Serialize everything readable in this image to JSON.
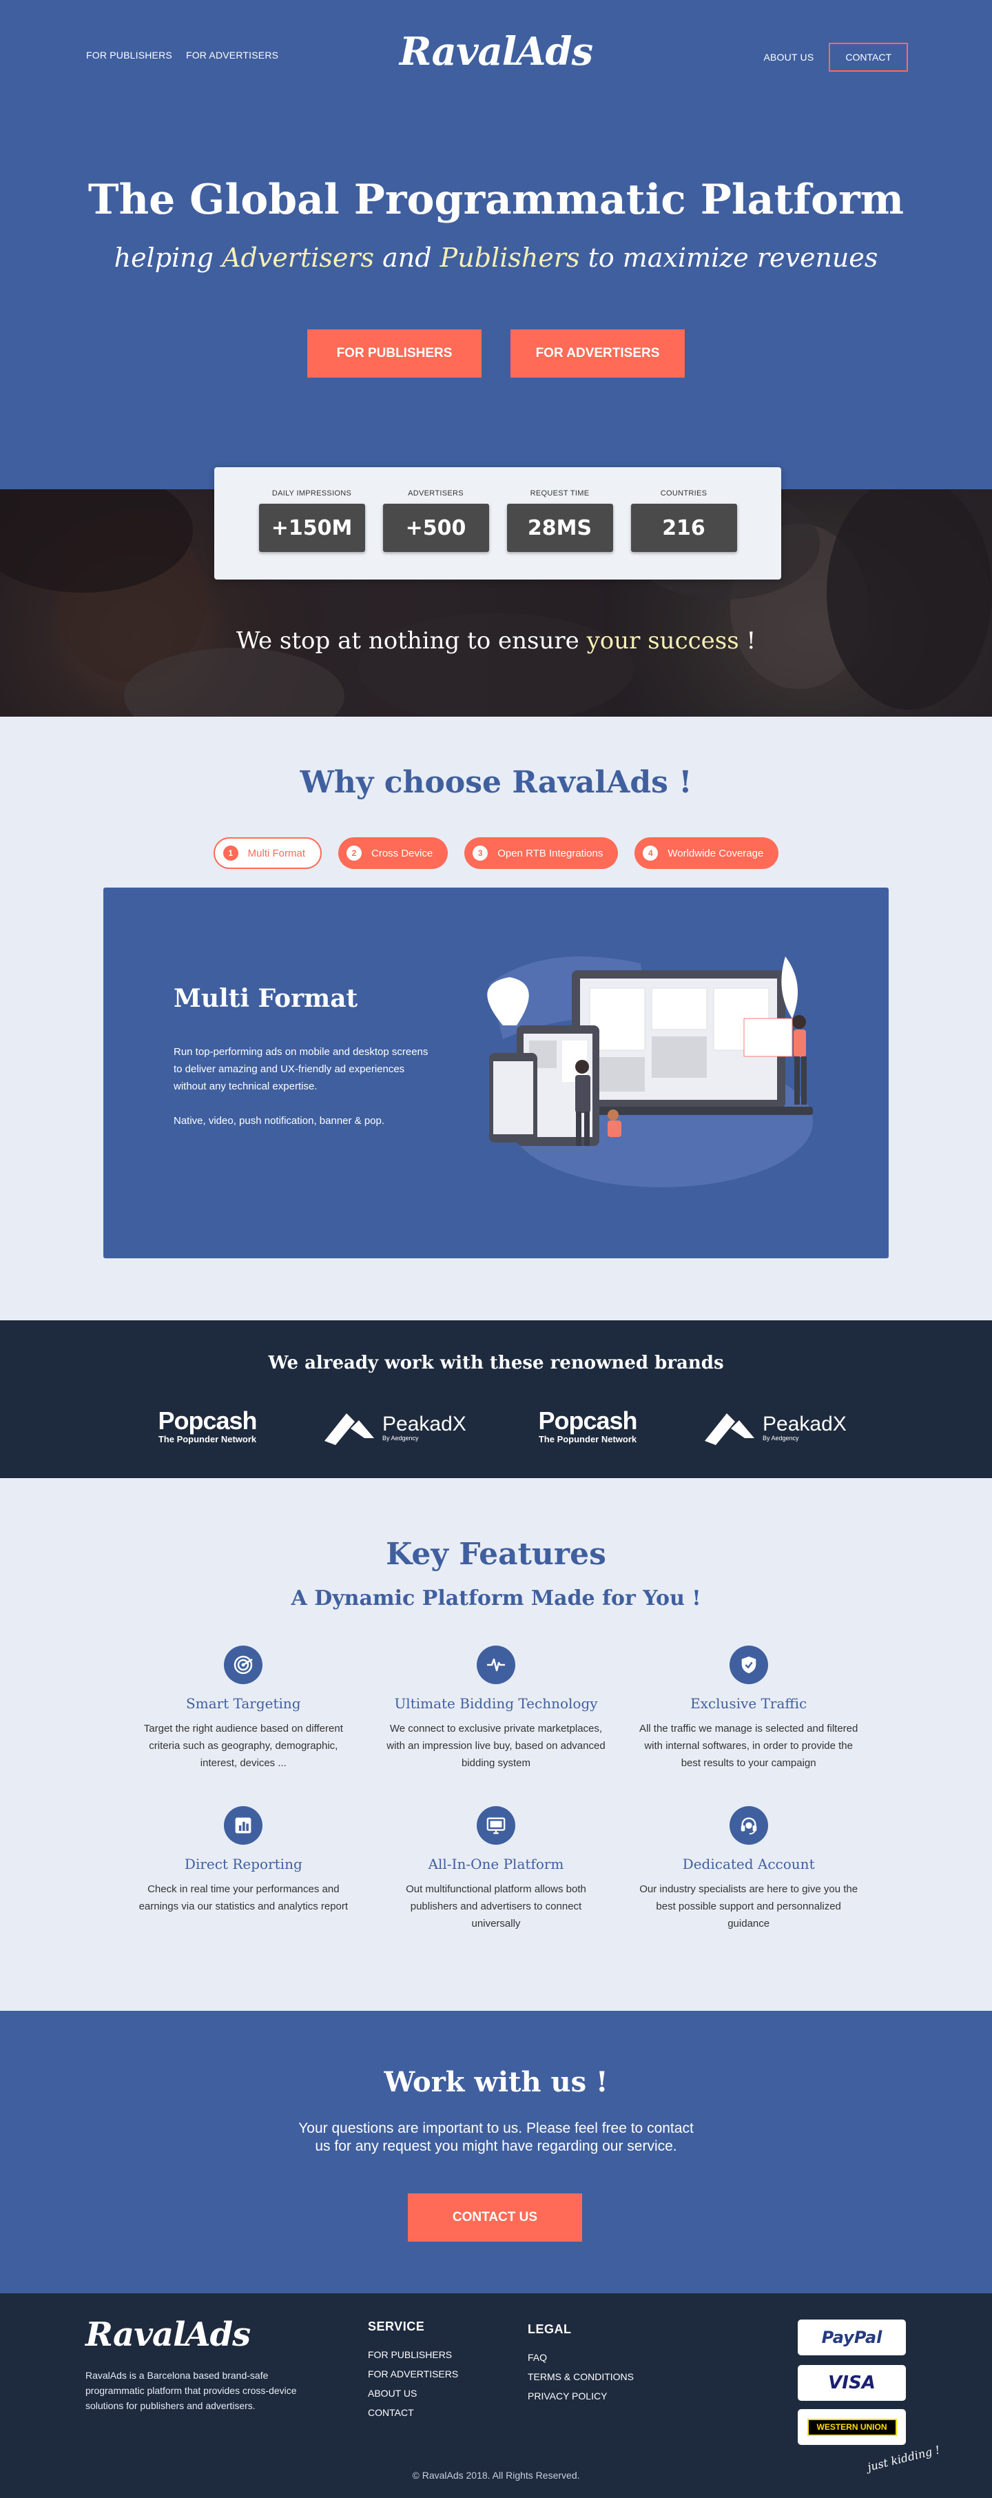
{
  "header": {
    "nav_left": [
      "FOR PUBLISHERS",
      "FOR ADVERTISERS"
    ],
    "logo": "RavalAds",
    "about": "ABOUT US",
    "contact": "CONTACT"
  },
  "hero": {
    "title": "The Global Programmatic Platform",
    "subtitle_parts": [
      "helping ",
      "Advertisers",
      " and ",
      "Publishers",
      " to maximize revenues"
    ],
    "buttons": [
      "FOR PUBLISHERS",
      "FOR ADVERTISERS"
    ]
  },
  "stats": [
    {
      "label": "DAILY IMPRESSIONS",
      "value": "+150M"
    },
    {
      "label": "ADVERTISERS",
      "value": "+500"
    },
    {
      "label": "REQUEST TIME",
      "value": "28MS"
    },
    {
      "label": "COUNTRIES",
      "value": "216"
    }
  ],
  "photo_band": {
    "text_main": "We stop at nothing to ensure ",
    "text_highlight": "your success",
    "text_end": " !"
  },
  "why": {
    "title": "Why choose RavalAds !",
    "tabs": [
      {
        "num": "1",
        "label": "Multi Format",
        "active": true
      },
      {
        "num": "2",
        "label": "Cross Device",
        "active": false
      },
      {
        "num": "3",
        "label": "Open RTB Integrations",
        "active": false
      },
      {
        "num": "4",
        "label": "Worldwide Coverage",
        "active": false
      }
    ],
    "panel": {
      "title": "Multi Format",
      "text": "Run top-performing  ads on mobile and desktop screens to deliver amazing and UX-friendly ad experiences without any technical expertise.",
      "text2": "Native, video, push notification, banner & pop."
    }
  },
  "brands": {
    "title": "We already work with these renowned brands",
    "items": [
      {
        "name": "Popcash",
        "sub": "The Popunder Network"
      },
      {
        "name": "PeakadX",
        "sub": "By Aedgency"
      },
      {
        "name": "Popcash",
        "sub": "The Popunder Network"
      },
      {
        "name": "PeakadX",
        "sub": "By Aedgency"
      }
    ]
  },
  "key_features": {
    "title": "Key Features",
    "subtitle": "A Dynamic Platform Made for You !",
    "items": [
      {
        "icon": "target-icon",
        "name": "Smart Targeting",
        "desc": "Target the right audience based on different criteria such as geography, demographic, interest, devices ..."
      },
      {
        "icon": "pulse-icon",
        "name": "Ultimate Bidding Technology",
        "desc": "We connect to exclusive private marketplaces, with an impression live buy, based on advanced bidding system"
      },
      {
        "icon": "shield-icon",
        "name": "Exclusive Traffic",
        "desc": "All the traffic we manage is selected and filtered with internal softwares, in order to provide the best results to your campaign"
      },
      {
        "icon": "chart-icon",
        "name": "Direct Reporting",
        "desc": "Check in real time your performances and earnings via our statistics and analytics report"
      },
      {
        "icon": "monitor-icon",
        "name": "All-In-One Platform",
        "desc": "Out multifunctional platform allows both publishers and advertisers to connect universally"
      },
      {
        "icon": "headset-icon",
        "name": "Dedicated Account",
        "desc": "Our industry specialists are here to give you the best possible support and personnalized guidance"
      }
    ]
  },
  "work": {
    "title": "Work with us !",
    "text_line1": "Your questions are important to us. Please feel free to contact",
    "text_line2": "us for any request you might have regarding our service.",
    "button": "CONTACT US"
  },
  "footer": {
    "logo": "RavalAds",
    "about": "RavalAds is a Barcelona based brand-safe programmatic platform that provides cross-device solutions for publishers and advertisers.",
    "service_title": "SERVICE",
    "service_links": [
      "FOR PUBLISHERS",
      "FOR ADVERTISERS",
      "ABOUT US",
      "CONTACT"
    ],
    "legal_title": "LEGAL",
    "legal_links": [
      "FAQ",
      "TERMS & CONDITIONS",
      "PRIVACY POLICY"
    ],
    "payments": [
      "PayPal",
      "VISA",
      "WESTERN UNION"
    ],
    "kidding": "just kidding !",
    "copyright": "© RavalAds 2018. All Rights Reserved."
  },
  "colors": {
    "primary": "#3f5f9f",
    "accent": "#ff6b57",
    "dark": "#1e2a3e",
    "highlight": "#f7f0b5"
  }
}
